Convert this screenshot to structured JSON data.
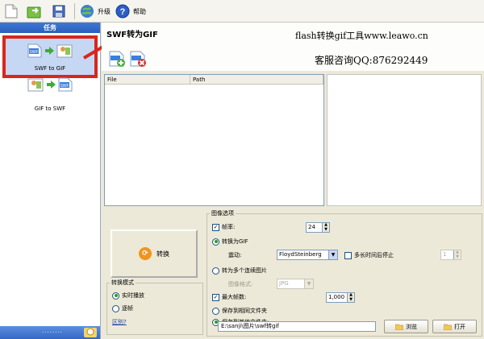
{
  "toolbar": {
    "items": [
      {
        "icon": "new-file-icon",
        "label": ""
      },
      {
        "icon": "open-icon",
        "label": ""
      },
      {
        "icon": "save-icon",
        "label": ""
      },
      {
        "icon": "upgrade-icon",
        "label": "升级"
      },
      {
        "icon": "help-icon",
        "label": "帮助"
      }
    ]
  },
  "sidebar": {
    "header": "任务",
    "items": [
      {
        "label": "SWF to GIF",
        "selected": true
      },
      {
        "label": "GIF to SWF",
        "selected": false
      }
    ],
    "footer_grip": "........"
  },
  "header": {
    "title": "SWF转为GIF",
    "site_text": "flash转换gif工具www.leawo.cn",
    "qq_text": "客服咨询QQ:876292449"
  },
  "file_list": {
    "columns": [
      "File",
      "Path"
    ],
    "rows": []
  },
  "convert": {
    "label": "转换"
  },
  "mode": {
    "legend": "转换模式",
    "realtime_label": "实时播放",
    "frame_label": "逐帧",
    "diff_link": "区别?",
    "selected": "realtime"
  },
  "options": {
    "legend": "图像选项",
    "fps_label": "帧率:",
    "fps_value": "24",
    "to_gif_label": "转换为GIF",
    "dither_label": "震动:",
    "dither_value": "FloydSteinberg",
    "stop_label": "多长时间后停止",
    "stop_value": "1",
    "to_images_label": "转为多个连续图片",
    "format_label": "图像格式:",
    "format_value": "JPG",
    "max_frames_label": "最大帧数:",
    "max_frames_value": "1,000",
    "same_folder_label": "保存到相同文件夹",
    "other_folder_label": "保存到其他文件夹:",
    "path_value": "E:\\sanji\\图片\\swf转gif",
    "browse_label": "浏览",
    "open_label": "打开"
  },
  "colors": {
    "selection_outline": "#d9261c",
    "sidebar_header": "#2b5fb8",
    "convert_icon": "#f0951b"
  }
}
